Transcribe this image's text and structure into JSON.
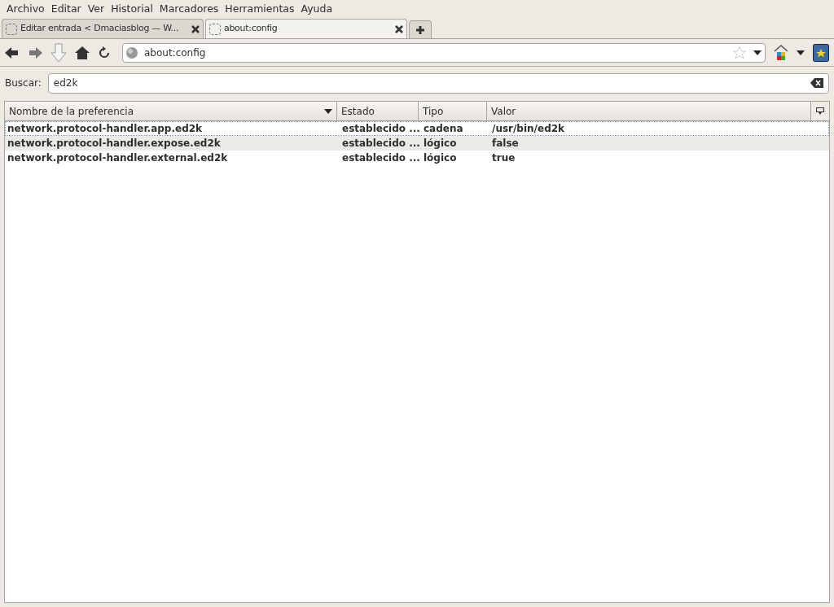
{
  "menu": [
    "Archivo",
    "Editar",
    "Ver",
    "Historial",
    "Marcadores",
    "Herramientas",
    "Ayuda"
  ],
  "tabs": [
    {
      "title": "Editar entrada < Dmaciasblog — W...",
      "selected": false
    },
    {
      "title": "about:config",
      "selected": true
    }
  ],
  "address": {
    "value": "about:config"
  },
  "search": {
    "label": "Buscar:",
    "value": "ed2k"
  },
  "table": {
    "columns": [
      "Nombre de la preferencia",
      "Estado",
      "Tipo",
      "Valor"
    ],
    "rows": [
      {
        "cells": [
          "network.protocol-handler.app.ed2k",
          "establecido ...",
          "cadena",
          "/usr/bin/ed2k"
        ],
        "selected": true
      },
      {
        "cells": [
          "network.protocol-handler.expose.ed2k",
          "establecido ...",
          "lógico",
          "false"
        ],
        "selected": false
      },
      {
        "cells": [
          "network.protocol-handler.external.ed2k",
          "establecido ...",
          "lógico",
          "true"
        ],
        "selected": false
      }
    ]
  }
}
